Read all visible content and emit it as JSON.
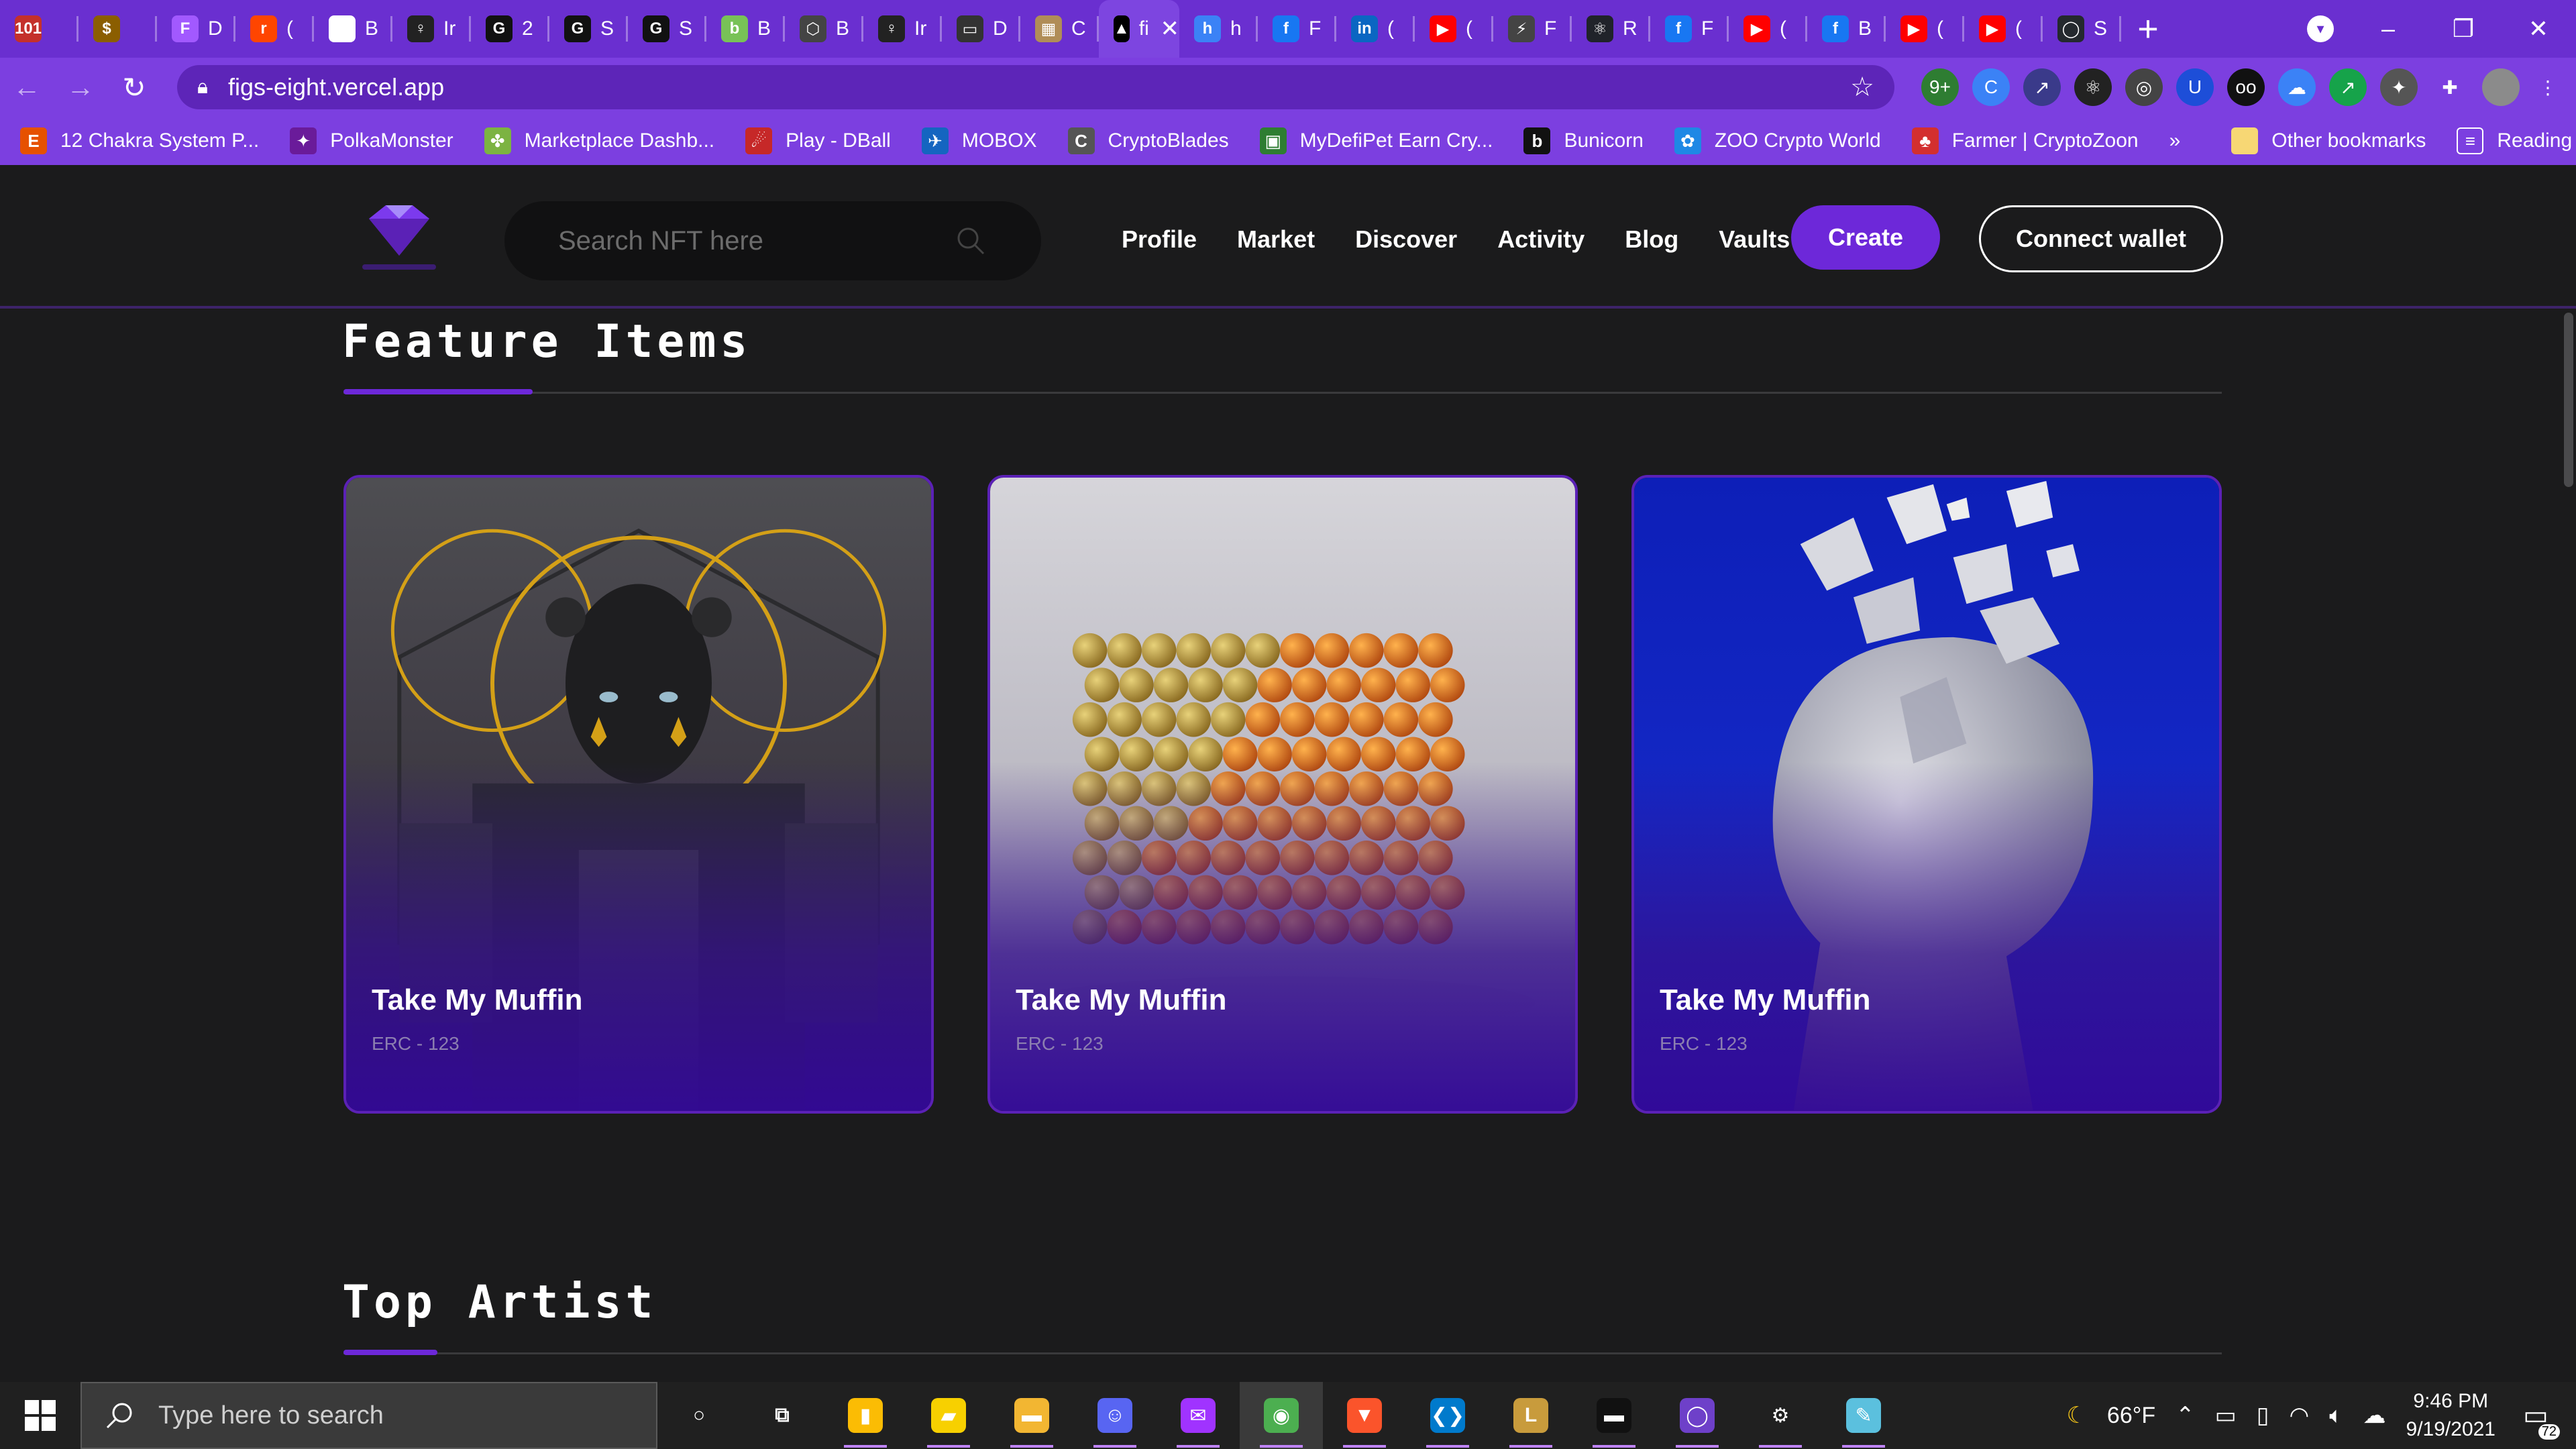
{
  "browser": {
    "tabs": [
      {
        "icon": "101",
        "title": "",
        "color": "#c4302b"
      },
      {
        "icon": "$",
        "title": "",
        "color": "#8b5e00"
      },
      {
        "icon": "F",
        "title": "D",
        "color": "#a259ff"
      },
      {
        "icon": "r",
        "title": "(",
        "color": "#ff4500"
      },
      {
        "icon": "◆",
        "title": "B",
        "color": "#ffffff"
      },
      {
        "icon": "♀",
        "title": "Ir",
        "color": "#222222"
      },
      {
        "icon": "G",
        "title": "2",
        "color": "#111111"
      },
      {
        "icon": "G",
        "title": "S",
        "color": "#111111"
      },
      {
        "icon": "G",
        "title": "S",
        "color": "#111111"
      },
      {
        "icon": "b",
        "title": "B",
        "color": "#78c257"
      },
      {
        "icon": "⬡",
        "title": "B",
        "color": "#444444"
      },
      {
        "icon": "♀",
        "title": "Ir",
        "color": "#222222"
      },
      {
        "icon": "▭",
        "title": "D",
        "color": "#333333"
      },
      {
        "icon": "▦",
        "title": "C",
        "color": "#b08d57"
      },
      {
        "icon": "▲",
        "title": "fi",
        "color": "#000000"
      },
      {
        "icon": "h",
        "title": "h",
        "color": "#3b82f6"
      },
      {
        "icon": "f",
        "title": "F",
        "color": "#1877f2"
      },
      {
        "icon": "in",
        "title": "(",
        "color": "#0a66c2"
      },
      {
        "icon": "▶",
        "title": "(",
        "color": "#ff0000"
      },
      {
        "icon": "⚡",
        "title": "F",
        "color": "#444444"
      },
      {
        "icon": "⚛",
        "title": "R",
        "color": "#20232a"
      },
      {
        "icon": "f",
        "title": "F",
        "color": "#1877f2"
      },
      {
        "icon": "▶",
        "title": "(",
        "color": "#ff0000"
      },
      {
        "icon": "f",
        "title": "B",
        "color": "#1877f2"
      },
      {
        "icon": "▶",
        "title": "(",
        "color": "#ff0000"
      },
      {
        "icon": "▶",
        "title": "(",
        "color": "#ff0000"
      },
      {
        "icon": "◯",
        "title": "S",
        "color": "#24292e"
      }
    ],
    "active_tab_index": 14,
    "url": "figs-eight.vercel.app",
    "extensions": [
      {
        "name": "9+",
        "color": "#2e7d32"
      },
      {
        "name": "C",
        "color": "#3b82f6"
      },
      {
        "name": "↗",
        "color": "#3a3a8a"
      },
      {
        "name": "⚛",
        "color": "#222"
      },
      {
        "name": "◎",
        "color": "#444"
      },
      {
        "name": "U",
        "color": "#1d4ed8"
      },
      {
        "name": "oo",
        "color": "#111"
      },
      {
        "name": "☁",
        "color": "#3b82f6"
      },
      {
        "name": "↗",
        "color": "#16a34a"
      },
      {
        "name": "✦",
        "color": "#555"
      }
    ],
    "bookmarks": [
      {
        "icon": "E",
        "label": "12 Chakra System P...",
        "color": "#e65100"
      },
      {
        "icon": "✦",
        "label": "PolkaMonster",
        "color": "#6a1b9a"
      },
      {
        "icon": "✤",
        "label": "Marketplace Dashb...",
        "color": "#7cb342"
      },
      {
        "icon": "☄",
        "label": "Play - DBall",
        "color": "#c62828"
      },
      {
        "icon": "✈",
        "label": "MOBOX",
        "color": "#1565c0"
      },
      {
        "icon": "C",
        "label": "CryptoBlades",
        "color": "#555555"
      },
      {
        "icon": "▣",
        "label": "MyDefiPet Earn Cry...",
        "color": "#2e7d32"
      },
      {
        "icon": "b",
        "label": "Bunicorn",
        "color": "#111111"
      },
      {
        "icon": "✿",
        "label": "ZOO Crypto World",
        "color": "#1e88e5"
      },
      {
        "icon": "♣",
        "label": "Farmer | CryptoZoon",
        "color": "#d32f2f"
      }
    ],
    "more_bookmarks": "»",
    "other_bookmarks": "Other bookmarks",
    "reading_list": "Reading list"
  },
  "site": {
    "search_placeholder": "Search NFT here",
    "nav": [
      "Profile",
      "Market",
      "Discover",
      "Activity",
      "Blog",
      "Vaults"
    ],
    "create_label": "Create",
    "wallet_label": "Connect wallet",
    "accent": "#6d28d9"
  },
  "featured": {
    "title": "Feature Items",
    "items": [
      {
        "name": "Take My Muffin",
        "token": "ERC - 123",
        "art": "robot-portrait"
      },
      {
        "name": "Take My Muffin",
        "token": "ERC - 123",
        "art": "orange-spheres-cube"
      },
      {
        "name": "Take My Muffin",
        "token": "ERC - 123",
        "art": "shattering-rock"
      }
    ]
  },
  "top_artist": {
    "title": "Top Artist"
  },
  "taskbar": {
    "search_placeholder": "Type here to search",
    "apps": [
      {
        "name": "cortana",
        "glyph": "○",
        "color": "transparent"
      },
      {
        "name": "task-view",
        "glyph": "⧉",
        "color": "transparent"
      },
      {
        "name": "keep",
        "glyph": "▮",
        "color": "#fbbc04"
      },
      {
        "name": "sticky-notes",
        "glyph": "▰",
        "color": "#f7d000"
      },
      {
        "name": "file-explorer",
        "glyph": "▬",
        "color": "#f2b632"
      },
      {
        "name": "discord",
        "glyph": "☺",
        "color": "#5865f2"
      },
      {
        "name": "messenger",
        "glyph": "✉",
        "color": "#a033ff"
      },
      {
        "name": "chrome",
        "glyph": "◉",
        "color": "#4caf50"
      },
      {
        "name": "brave",
        "glyph": "▼",
        "color": "#fb542b"
      },
      {
        "name": "vscode",
        "glyph": "❮❯",
        "color": "#007acc"
      },
      {
        "name": "league-of-legends",
        "glyph": "L",
        "color": "#c89b3c"
      },
      {
        "name": "terminal",
        "glyph": "▬",
        "color": "#111111"
      },
      {
        "name": "github-desktop",
        "glyph": "◯",
        "color": "#6e40c9"
      },
      {
        "name": "settings",
        "glyph": "⚙",
        "color": "transparent"
      },
      {
        "name": "paint",
        "glyph": "✎",
        "color": "#5bc0de"
      }
    ],
    "weather": "66°F",
    "time": "9:46 PM",
    "date": "9/19/2021",
    "notifications": "72"
  }
}
